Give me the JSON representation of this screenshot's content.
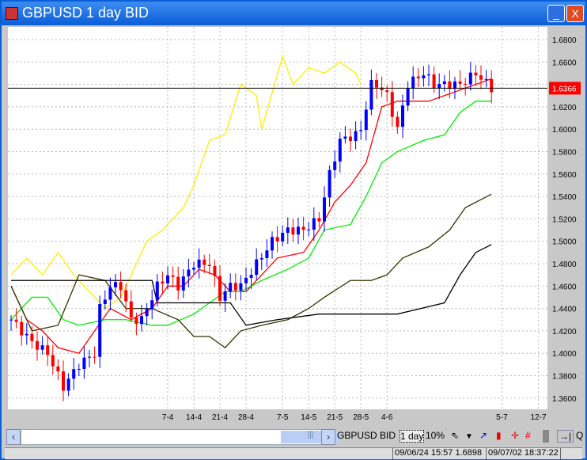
{
  "window": {
    "title": "GBPUSD 1 day BID",
    "minimize": "_",
    "close": "X"
  },
  "toolbar": {
    "symbol": "GBPUSD",
    "side": "BID",
    "period": "1 day",
    "zoom": "10%",
    "q": "Q",
    "icons": [
      "cursor-icon",
      "dropdown-icon",
      "line-tool-icon",
      "candle-icon",
      "crosshair-icon",
      "grid-icon",
      "panel-icon",
      "goto-end-icon"
    ]
  },
  "status": {
    "cursor_readout": "09/06/24 15:57 1.6898",
    "clock": "09/07/02 18:37:22"
  },
  "chart_data": {
    "type": "candlestick",
    "symbol": "GBPUSD",
    "current_price": "1.6366",
    "ylim": [
      1.35,
      1.69
    ],
    "y_ticks": [
      "1.6800",
      "1.6600",
      "1.6400",
      "1.6200",
      "1.6000",
      "1.5800",
      "1.5600",
      "1.5400",
      "1.5200",
      "1.5000",
      "1.4800",
      "1.4600",
      "1.4400",
      "1.4200",
      "1.4000",
      "1.3800",
      "1.3600"
    ],
    "x_ticks": [
      {
        "label": "7-4",
        "i": 30
      },
      {
        "label": "14-4",
        "i": 35
      },
      {
        "label": "21-4",
        "i": 40
      },
      {
        "label": "28-4",
        "i": 45
      },
      {
        "label": "7-5",
        "i": 52
      },
      {
        "label": "14-5",
        "i": 57
      },
      {
        "label": "21-5",
        "i": 62
      },
      {
        "label": "28-5",
        "i": 67
      },
      {
        "label": "4-6",
        "i": 72
      },
      {
        "label": "5-7",
        "i": 94
      },
      {
        "label": "12-7",
        "i": 101
      }
    ],
    "close_keypoints": [
      [
        0,
        1.43
      ],
      [
        4,
        1.41
      ],
      [
        7,
        1.4
      ],
      [
        10,
        1.37
      ],
      [
        13,
        1.39
      ],
      [
        16,
        1.4
      ],
      [
        17,
        1.44
      ],
      [
        19,
        1.46
      ],
      [
        21,
        1.46
      ],
      [
        23,
        1.43
      ],
      [
        25,
        1.43
      ],
      [
        28,
        1.46
      ],
      [
        30,
        1.47
      ],
      [
        32,
        1.46
      ],
      [
        35,
        1.48
      ],
      [
        38,
        1.48
      ],
      [
        40,
        1.45
      ],
      [
        42,
        1.46
      ],
      [
        44,
        1.46
      ],
      [
        47,
        1.48
      ],
      [
        50,
        1.5
      ],
      [
        53,
        1.51
      ],
      [
        56,
        1.51
      ],
      [
        59,
        1.52
      ],
      [
        61,
        1.56
      ],
      [
        63,
        1.59
      ],
      [
        66,
        1.595
      ],
      [
        67,
        1.6
      ],
      [
        69,
        1.64
      ],
      [
        70,
        1.64
      ],
      [
        72,
        1.63
      ],
      [
        74,
        1.6
      ],
      [
        76,
        1.64
      ],
      [
        79,
        1.65
      ],
      [
        81,
        1.64
      ],
      [
        83,
        1.64
      ],
      [
        86,
        1.64
      ],
      [
        89,
        1.65
      ],
      [
        92,
        1.6366
      ]
    ],
    "series": [
      {
        "name": "lagging",
        "color": "#ffee00",
        "points": [
          [
            0,
            1.47
          ],
          [
            3,
            1.485
          ],
          [
            6,
            1.47
          ],
          [
            9,
            1.49
          ],
          [
            12,
            1.47
          ],
          [
            15,
            1.455
          ],
          [
            18,
            1.44
          ],
          [
            21,
            1.45
          ],
          [
            24,
            1.48
          ],
          [
            26,
            1.5
          ],
          [
            29,
            1.51
          ],
          [
            31,
            1.52
          ],
          [
            33,
            1.53
          ],
          [
            35,
            1.55
          ],
          [
            38,
            1.59
          ],
          [
            41,
            1.595
          ],
          [
            44,
            1.64
          ],
          [
            47,
            1.63
          ],
          [
            48,
            1.6
          ],
          [
            52,
            1.665
          ],
          [
            54,
            1.64
          ],
          [
            57,
            1.655
          ],
          [
            60,
            1.65
          ],
          [
            63,
            1.66
          ],
          [
            66,
            1.65
          ],
          [
            67,
            1.64
          ]
        ]
      },
      {
        "name": "conversion",
        "color": "#ff0000",
        "points": [
          [
            0,
            1.46
          ],
          [
            3,
            1.43
          ],
          [
            6,
            1.42
          ],
          [
            9,
            1.405
          ],
          [
            13,
            1.4
          ],
          [
            16,
            1.42
          ],
          [
            19,
            1.44
          ],
          [
            23,
            1.43
          ],
          [
            27,
            1.44
          ],
          [
            30,
            1.46
          ],
          [
            33,
            1.46
          ],
          [
            36,
            1.475
          ],
          [
            39,
            1.47
          ],
          [
            42,
            1.455
          ],
          [
            45,
            1.455
          ],
          [
            48,
            1.47
          ],
          [
            51,
            1.485
          ],
          [
            56,
            1.49
          ],
          [
            59,
            1.51
          ],
          [
            62,
            1.535
          ],
          [
            65,
            1.55
          ],
          [
            68,
            1.57
          ],
          [
            71,
            1.62
          ],
          [
            74,
            1.625
          ],
          [
            77,
            1.625
          ],
          [
            80,
            1.625
          ],
          [
            83,
            1.63
          ],
          [
            86,
            1.635
          ],
          [
            89,
            1.64
          ],
          [
            92,
            1.645
          ]
        ]
      },
      {
        "name": "base",
        "color": "#00ee00",
        "points": [
          [
            0,
            1.43
          ],
          [
            4,
            1.45
          ],
          [
            7,
            1.45
          ],
          [
            10,
            1.43
          ],
          [
            13,
            1.425
          ],
          [
            18,
            1.43
          ],
          [
            22,
            1.43
          ],
          [
            27,
            1.425
          ],
          [
            30,
            1.425
          ],
          [
            35,
            1.435
          ],
          [
            38,
            1.445
          ],
          [
            41,
            1.455
          ],
          [
            44,
            1.455
          ],
          [
            48,
            1.465
          ],
          [
            53,
            1.475
          ],
          [
            57,
            1.485
          ],
          [
            60,
            1.51
          ],
          [
            65,
            1.515
          ],
          [
            68,
            1.54
          ],
          [
            71,
            1.57
          ],
          [
            74,
            1.58
          ],
          [
            79,
            1.59
          ],
          [
            83,
            1.595
          ],
          [
            86,
            1.615
          ],
          [
            89,
            1.625
          ],
          [
            92,
            1.625
          ]
        ]
      },
      {
        "name": "span-a",
        "color": "#333300",
        "points": [
          [
            0,
            1.46
          ],
          [
            4,
            1.42
          ],
          [
            9,
            1.425
          ],
          [
            13,
            1.47
          ],
          [
            18,
            1.465
          ],
          [
            22,
            1.44
          ],
          [
            27,
            1.44
          ],
          [
            32,
            1.43
          ],
          [
            35,
            1.415
          ],
          [
            38,
            1.415
          ],
          [
            41,
            1.405
          ],
          [
            44,
            1.42
          ],
          [
            48,
            1.425
          ],
          [
            53,
            1.43
          ],
          [
            57,
            1.44
          ],
          [
            60,
            1.45
          ],
          [
            65,
            1.465
          ],
          [
            69,
            1.465
          ],
          [
            72,
            1.47
          ],
          [
            75,
            1.485
          ],
          [
            80,
            1.495
          ],
          [
            84,
            1.51
          ],
          [
            87,
            1.53
          ],
          [
            92,
            1.542
          ]
        ]
      },
      {
        "name": "span-b",
        "color": "#000000",
        "points": [
          [
            0,
            1.465
          ],
          [
            27,
            1.465
          ],
          [
            28,
            1.445
          ],
          [
            42,
            1.445
          ],
          [
            45,
            1.425
          ],
          [
            51,
            1.43
          ],
          [
            59,
            1.435
          ],
          [
            74,
            1.435
          ],
          [
            83,
            1.445
          ],
          [
            86,
            1.47
          ],
          [
            89,
            1.49
          ],
          [
            92,
            1.497
          ]
        ]
      }
    ]
  }
}
